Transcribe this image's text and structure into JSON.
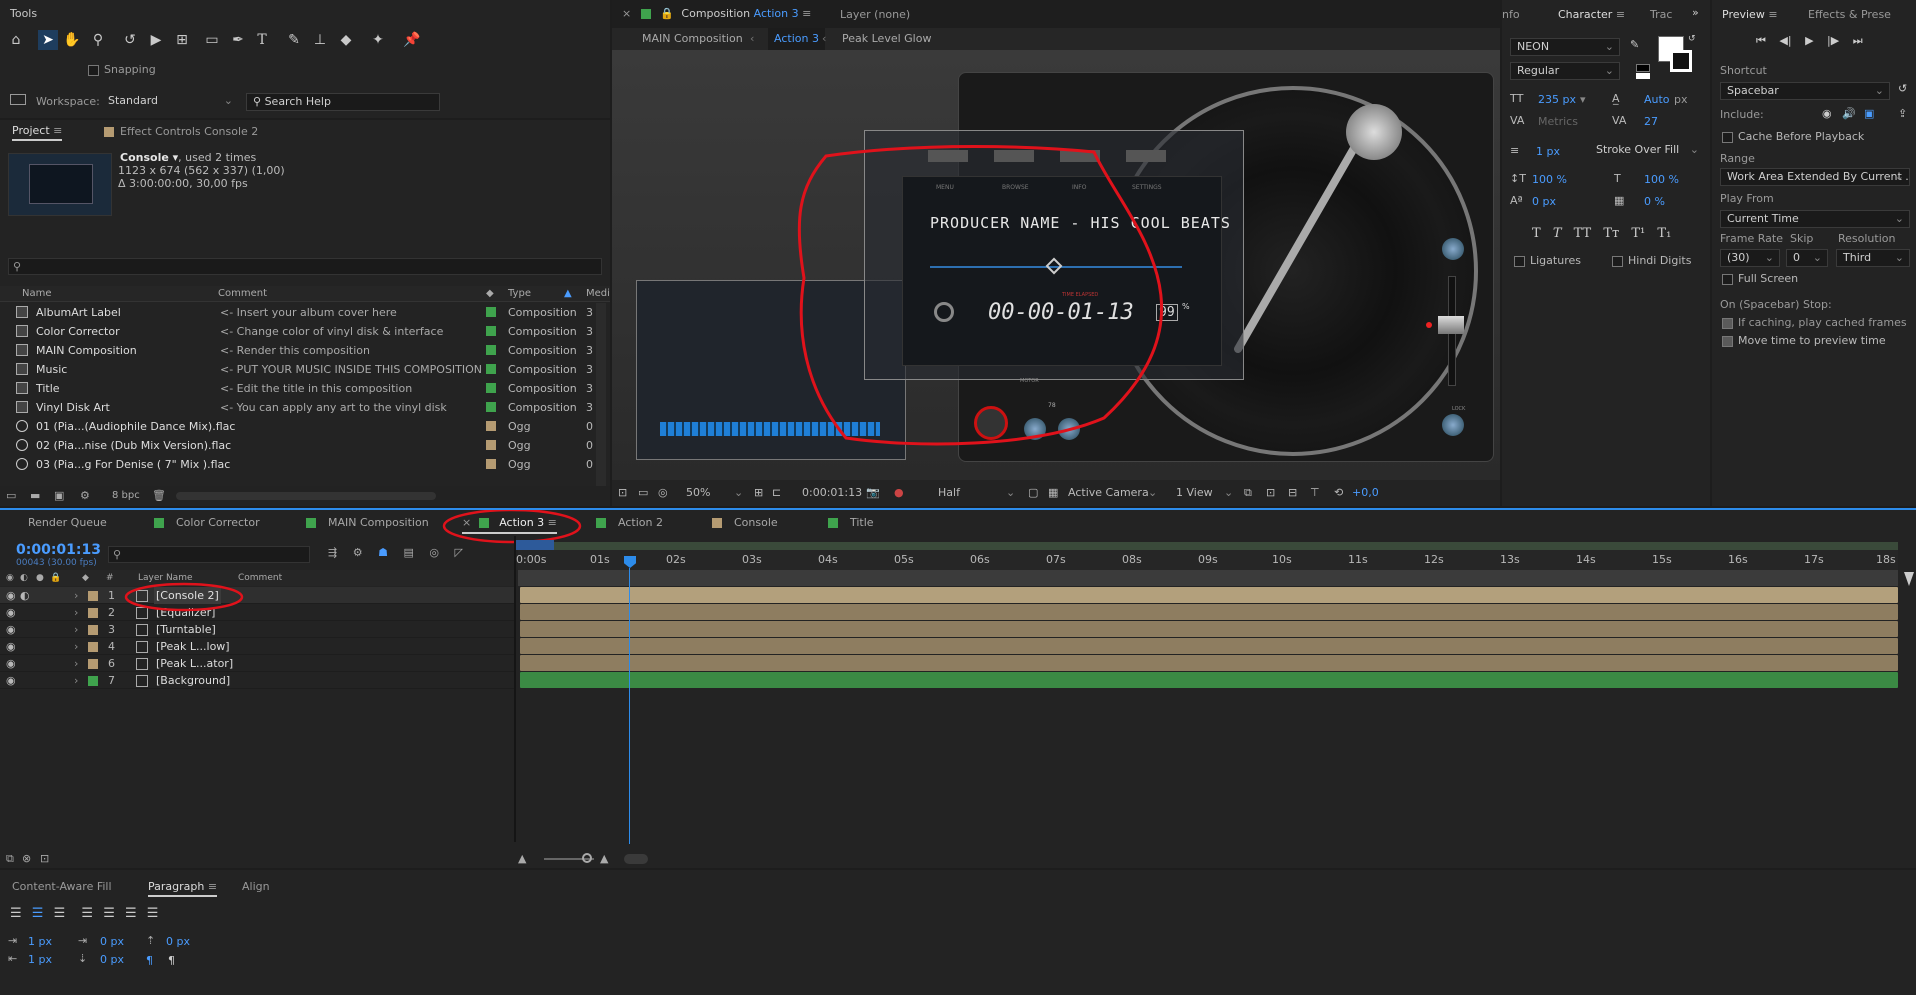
{
  "tools": {
    "title": "Tools",
    "snapping_label": "Snapping",
    "workspace_label": "Workspace:",
    "workspace_value": "Standard",
    "search_help": "Search Help"
  },
  "project": {
    "tab_project": "Project",
    "tab_effect_controls": "Effect Controls Console 2",
    "item_name": "Console",
    "item_used": ", used 2 times",
    "item_dims": "1123 x 674  (562 x 337) (1,00)",
    "item_duration": "Δ 3:00:00:00, 30,00 fps",
    "columns": [
      "Name",
      "Comment",
      "Type",
      "Medi"
    ],
    "rows": [
      {
        "name": "AlbumArt Label",
        "comment": "<- Insert your album cover here",
        "type": "Composition",
        "media": "3"
      },
      {
        "name": "Color Corrector",
        "comment": "<- Change color of vinyl disk & interface",
        "type": "Composition",
        "media": "3"
      },
      {
        "name": "MAIN Composition",
        "comment": "<- Render this composition",
        "type": "Composition",
        "media": "3"
      },
      {
        "name": "Music",
        "comment": "<- PUT YOUR MUSIC INSIDE THIS COMPOSITION",
        "type": "Composition",
        "media": "3"
      },
      {
        "name": "Title",
        "comment": "<- Edit the title in this composition",
        "type": "Composition",
        "media": "3"
      },
      {
        "name": "Vinyl Disk Art",
        "comment": "<- You can apply any art to the vinyl disk",
        "type": "Composition",
        "media": "3"
      },
      {
        "name": "01 (Pia...(Audiophile Dance Mix).flac",
        "comment": "",
        "type": "Ogg",
        "media": "0"
      },
      {
        "name": "02 (Pia...nise (Dub Mix Version).flac",
        "comment": "",
        "type": "Ogg",
        "media": "0"
      },
      {
        "name": "03 (Pia...g For Denise ( 7\" Mix ).flac",
        "comment": "",
        "type": "Ogg",
        "media": "0"
      }
    ],
    "bpc": "8 bpc"
  },
  "viewer": {
    "tab_composition_prefix": "Composition",
    "tab_composition_name": "Action 3",
    "tab_layer": "Layer (none)",
    "breadcrumbs": [
      "MAIN Composition",
      "Action 3",
      "Peak Level Glow"
    ],
    "screen_title": "PRODUCER NAME - HIS COOL BEATS",
    "screen_time": "00-00-01-13",
    "screen_time_label": "TIME ELAPSED",
    "screen_volume": "99",
    "screen_volume_unit": "%",
    "screen_menu": [
      "MENU",
      "BROWSE",
      "INFO",
      "SETTINGS"
    ],
    "motor_label": "MOTOR",
    "lock_label": "LOCK",
    "speed_label": "78",
    "zoom": "50%",
    "timecode": "0:00:01:13",
    "resolution": "Half",
    "camera": "Active Camera",
    "views": "1 View",
    "exposure": "+0,0"
  },
  "character": {
    "tab_info": "nfo",
    "tab_character": "Character",
    "tab_tracker": "Trac",
    "font": "NEON",
    "style": "Regular",
    "size": "235 px",
    "leading": "Auto",
    "leading_unit": "px",
    "kerning": "Metrics",
    "tracking": "27",
    "stroke_width": "1 px",
    "stroke_mode": "Stroke Over Fill",
    "vscale": "100 %",
    "hscale": "100 %",
    "baseline": "0 px",
    "tsume": "0 %",
    "ligatures": "Ligatures",
    "hindi_digits": "Hindi Digits"
  },
  "preview": {
    "tab_preview": "Preview",
    "tab_effects": "Effects & Prese",
    "shortcut_label": "Shortcut",
    "shortcut_value": "Spacebar",
    "include_label": "Include:",
    "cache_label": "Cache Before Playback",
    "range_label": "Range",
    "range_value": "Work Area Extended By Current ...",
    "play_from_label": "Play From",
    "play_from_value": "Current Time",
    "frame_rate_label": "Frame Rate",
    "skip_label": "Skip",
    "resolution_label": "Resolution",
    "frame_rate_value": "(30)",
    "skip_value": "0",
    "resolution_value": "Third",
    "full_screen": "Full Screen",
    "on_stop_label": "On (Spacebar) Stop:",
    "if_caching": "If caching, play cached frames",
    "move_time": "Move time to preview time"
  },
  "timeline": {
    "tabs": [
      "Render Queue",
      "Color Corrector",
      "MAIN Composition",
      "Action 3",
      "Action 2",
      "Console",
      "Title"
    ],
    "timecode": "0:00:01:13",
    "frame_info": "00043 (30.00 fps)",
    "col_layer_name": "Layer Name",
    "col_comment": "Comment",
    "col_num": "#",
    "layers": [
      {
        "num": "1",
        "name": "[Console 2]"
      },
      {
        "num": "2",
        "name": "[Equalizer]"
      },
      {
        "num": "3",
        "name": "[Turntable]"
      },
      {
        "num": "4",
        "name": "[Peak L...low]"
      },
      {
        "num": "6",
        "name": "[Peak L...ator]"
      },
      {
        "num": "7",
        "name": "[Background]"
      }
    ],
    "ticks": [
      "0:00s",
      "01s",
      "02s",
      "03s",
      "04s",
      "05s",
      "06s",
      "07s",
      "08s",
      "09s",
      "10s",
      "11s",
      "12s",
      "13s",
      "14s",
      "15s",
      "16s",
      "17s",
      "18s"
    ]
  },
  "paragraph": {
    "tab_content_aware": "Content-Aware Fill",
    "tab_paragraph": "Paragraph",
    "tab_align": "Align",
    "indent_left": "1 px",
    "indent_first": "0 px",
    "space_before": "0 px",
    "indent_right": "1 px",
    "space_after": "0 px"
  },
  "colors": {
    "accent": "#2d8ceb",
    "green_label": "#3fa34d",
    "tan_label": "#b59b72",
    "annotation_red": "#e0121b"
  }
}
